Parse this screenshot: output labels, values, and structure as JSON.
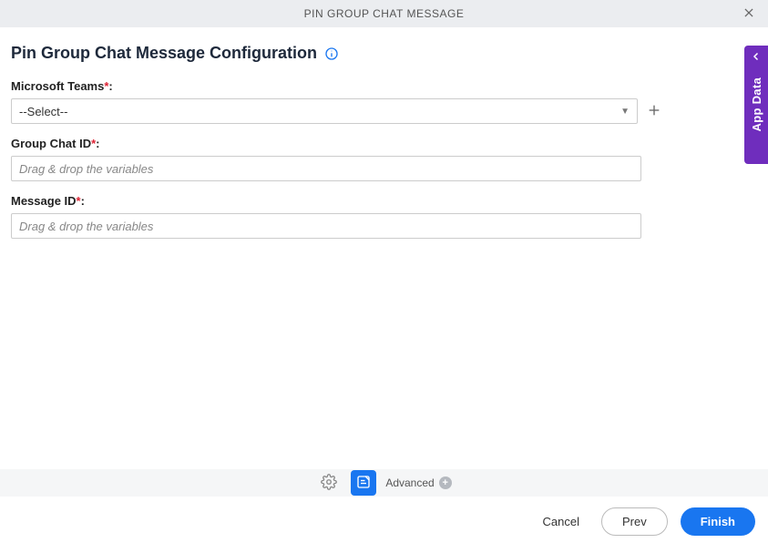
{
  "titlebar": {
    "title": "PIN GROUP CHAT MESSAGE"
  },
  "page": {
    "heading": "Pin Group Chat Message Configuration"
  },
  "fields": {
    "teams": {
      "label": "Microsoft Teams",
      "required_marker": "*",
      "colon": ":",
      "selected": "--Select--"
    },
    "groupchat": {
      "label": "Group Chat ID",
      "required_marker": "*",
      "colon": ":",
      "placeholder": "Drag & drop the variables",
      "value": ""
    },
    "message": {
      "label": "Message ID",
      "required_marker": "*",
      "colon": ":",
      "placeholder": "Drag & drop the variables",
      "value": ""
    }
  },
  "sidepanel": {
    "label": "App Data"
  },
  "toolbar": {
    "advanced_label": "Advanced"
  },
  "footer": {
    "cancel": "Cancel",
    "prev": "Prev",
    "finish": "Finish"
  },
  "icons": {
    "close": "close-icon",
    "info": "info-icon",
    "plus": "plus-icon",
    "gear": "gear-icon",
    "note": "note-icon",
    "chevron_left": "chevron-left-icon",
    "caret_down": "caret-down-icon"
  },
  "colors": {
    "primary": "#1976f0",
    "accent_purple": "#6f2dbd",
    "required": "#d23"
  }
}
